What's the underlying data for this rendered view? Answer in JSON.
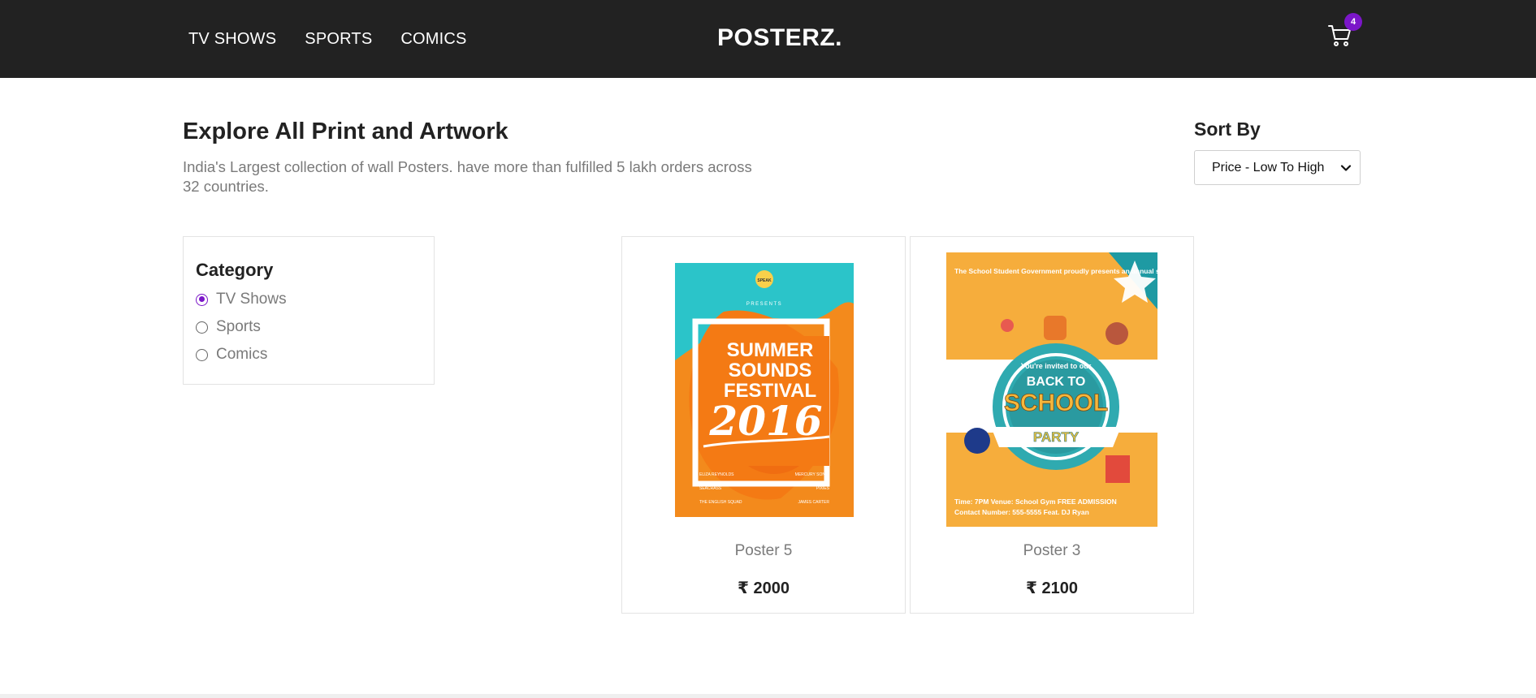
{
  "nav": {
    "links": [
      "TV SHOWS",
      "SPORTS",
      "COMICS"
    ],
    "brand": "POSTERZ.",
    "cart_count": "4"
  },
  "header": {
    "title": "Explore All Print and Artwork",
    "description": "India's Largest collection of wall Posters. have more than fulfilled 5 lakh orders across 32 countries."
  },
  "sort": {
    "label": "Sort By",
    "selected": "Price - Low To High"
  },
  "category": {
    "title": "Category",
    "options": [
      {
        "label": "TV Shows",
        "checked": true
      },
      {
        "label": "Sports",
        "checked": false
      },
      {
        "label": "Comics",
        "checked": false
      }
    ]
  },
  "products": [
    {
      "name": "Poster 5",
      "price": "₹ 2000",
      "art": {
        "top_badge": "SPEAK",
        "presents": "PRESENTS",
        "line1": "SUMMER",
        "line2": "SOUNDS",
        "line3": "FESTIVAL",
        "year": "2016",
        "credits": [
          "ELIZA REYNOLDS",
          "MERCURY SONIC",
          "SEACRASS",
          "PIXIES",
          "THE ENGLISH SQUAD",
          "JAMES CARTER"
        ]
      }
    },
    {
      "name": "Poster 3",
      "price": "₹ 2100",
      "art": {
        "intro": "The School Student Government proudly presents an annual school event.",
        "invite": "You're invited to our",
        "line1": "BACK TO",
        "line2": "SCHOOL",
        "line3": "PARTY",
        "info1": "Time: 7PM   Venue: School Gym   FREE ADMISSION",
        "info2": "Contact Number: 555-5555   Feat. DJ Ryan"
      }
    }
  ],
  "colors": {
    "navbar": "#222222",
    "accent": "#7b16c8"
  }
}
